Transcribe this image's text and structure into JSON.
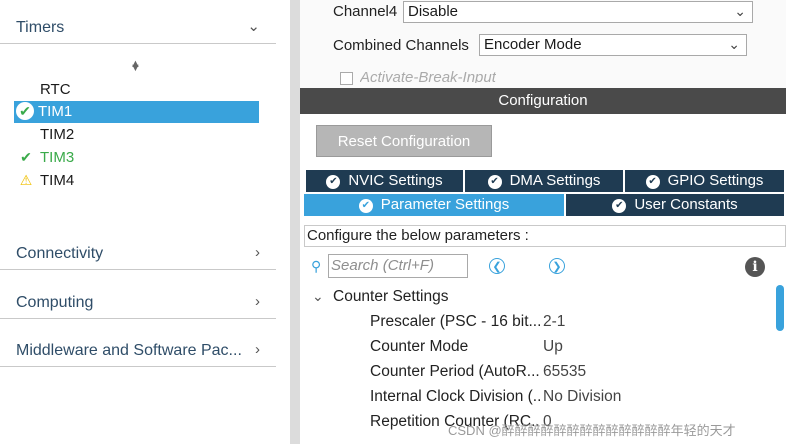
{
  "left_panel": {
    "timers_category": "Timers",
    "tree_items": [
      {
        "label": "RTC"
      },
      {
        "label": "TIM1"
      },
      {
        "label": "TIM2"
      },
      {
        "label": "TIM3"
      },
      {
        "label": "TIM4"
      }
    ],
    "categories": [
      "Connectivity",
      "Computing",
      "Middleware and Software Pac..."
    ]
  },
  "mode_settings": {
    "channel4_label": "Channel4",
    "channel4_value": "Disable",
    "combined_label": "Combined Channels",
    "combined_value": "Encoder Mode",
    "break_label": "Activate-Break-Input"
  },
  "configuration": {
    "title": "Configuration",
    "reset_label": "Reset Configuration",
    "tabs_row1": [
      "NVIC Settings",
      "DMA Settings",
      "GPIO Settings"
    ],
    "tabs_row2": [
      "Parameter Settings",
      "User Constants"
    ],
    "configure_label": "Configure the below parameters :",
    "search_placeholder": "Search (Ctrl+F)",
    "section_title": "Counter Settings",
    "params": [
      {
        "name": "Prescaler (PSC - 16 bit...",
        "value": "2-1"
      },
      {
        "name": "Counter Mode",
        "value": "Up"
      },
      {
        "name": "Counter Period (AutoR...",
        "value": "65535"
      },
      {
        "name": "Internal Clock Division (...",
        "value": "No Division"
      },
      {
        "name": "Repetition Counter (RC...",
        "value": "0"
      }
    ]
  },
  "watermark": "CSDN @醉醉醉醉醉醉醉醉醉醉醉醉醉年轻的天才",
  "colors": {
    "accent": "#39a2dc",
    "dark_tab": "#1f3b52",
    "header": "#4a4a4a",
    "ok_green": "#3aaa4a",
    "warn_yellow": "#f0c000"
  }
}
